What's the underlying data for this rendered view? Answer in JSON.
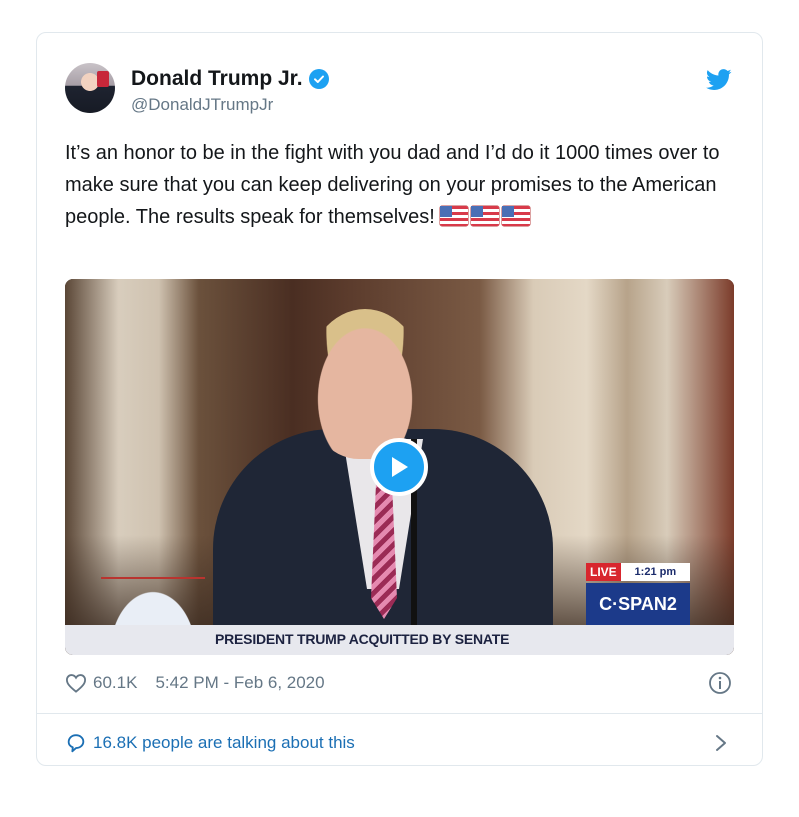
{
  "author": {
    "display_name": "Donald Trump Jr.",
    "handle": "@DonaldJTrumpJr",
    "verified": true
  },
  "tweet": {
    "text": "It’s an honor to be in the fight with you dad and I’d do it 1000 times over to make sure that you can keep delivering on your promises to the American people. The results speak for themselves!",
    "emoji_count": 3,
    "emoji_name": "us-flag-emoji"
  },
  "video": {
    "lower_third": "PRESIDENT TRUMP ACQUITTED BY SENATE",
    "live_label": "LIVE",
    "time_label": "1:21 pm ET",
    "network": "C·SPAN2"
  },
  "meta": {
    "likes": "60.1K",
    "timestamp": "5:42 PM - Feb 6, 2020"
  },
  "footer": {
    "talk_text": "16.8K people are talking about this"
  },
  "colors": {
    "twitter_blue": "#1da1f2",
    "link_blue": "#1b6fb4",
    "secondary_text": "#657786",
    "border": "#e1e8ed"
  },
  "icons": [
    "twitter-bird-icon",
    "verified-badge-icon",
    "play-icon",
    "heart-icon",
    "info-icon",
    "comment-bubble-icon",
    "chevron-right-icon"
  ]
}
